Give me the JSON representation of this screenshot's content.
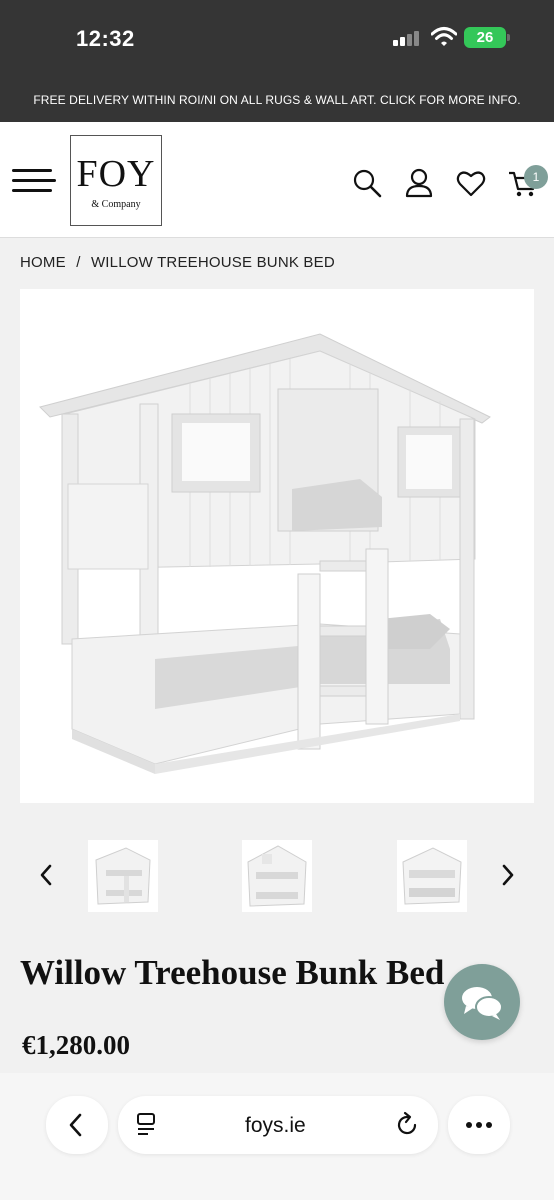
{
  "status_bar": {
    "time": "12:32",
    "battery": "26"
  },
  "promo_banner": "FREE DELIVERY WITHIN ROI/NI ON ALL RUGS & WALL ART. CLICK FOR MORE INFO.",
  "header": {
    "logo_main": "FOY",
    "logo_sub": "& Company",
    "icons": [
      "menu-icon",
      "search-icon",
      "account-icon",
      "heart-icon",
      "cart-icon"
    ],
    "cart_count": "1"
  },
  "breadcrumb": {
    "home": "HOME",
    "separator": "/",
    "current": "WILLOW TREEHOUSE BUNK BED"
  },
  "product": {
    "title": "Willow Treehouse Bunk Bed",
    "price": "€1,280.00"
  },
  "browser": {
    "url": "foys.ie"
  },
  "colors": {
    "accent": "#7f9f99",
    "dark_bar": "#353535"
  }
}
